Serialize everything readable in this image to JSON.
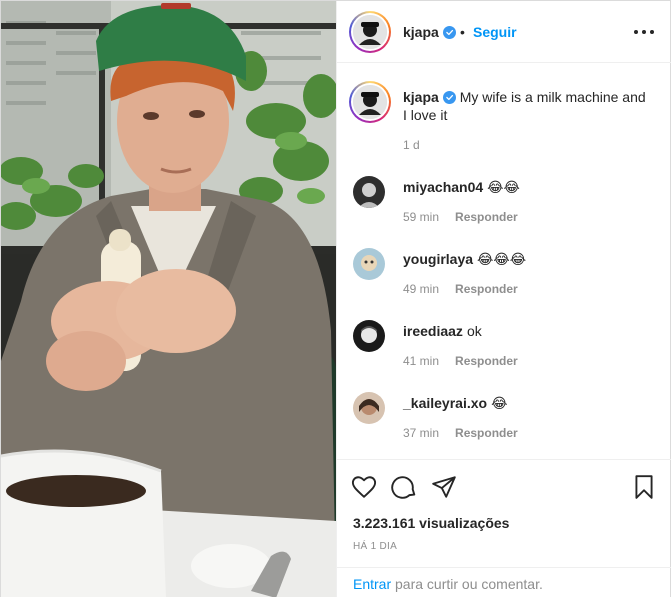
{
  "post": {
    "username": "kjapa",
    "verified": true,
    "follow_label": "Seguir",
    "separator": "•",
    "more_icon": "more-options-icon"
  },
  "caption": {
    "username": "kjapa",
    "text": "My wife is a milk machine and I love it",
    "time": "1 d"
  },
  "comments": [
    {
      "username": "miyachan04",
      "text": "😂😂",
      "time": "59 min",
      "reply_label": "Responder"
    },
    {
      "username": "yougirlaya",
      "text": "😂😂😂",
      "time": "49 min",
      "reply_label": "Responder"
    },
    {
      "username": "ireediaaz",
      "text": "ok",
      "time": "41 min",
      "reply_label": "Responder"
    },
    {
      "username": "_kaileyrai.xo",
      "text": "😂",
      "time": "37 min",
      "reply_label": "Responder"
    }
  ],
  "actions": {
    "like_icon": "heart-icon",
    "comment_icon": "comment-icon",
    "share_icon": "send-icon",
    "save_icon": "bookmark-icon"
  },
  "stats": {
    "views": "3.223.161 visualizações",
    "date": "HÁ 1 DIA"
  },
  "login": {
    "link_label": "Entrar",
    "rest_text": " para curtir ou comentar."
  },
  "colors": {
    "link_blue": "#0095f6",
    "muted_gray": "#8e8e8e",
    "text": "#262626",
    "border": "#efefef"
  }
}
